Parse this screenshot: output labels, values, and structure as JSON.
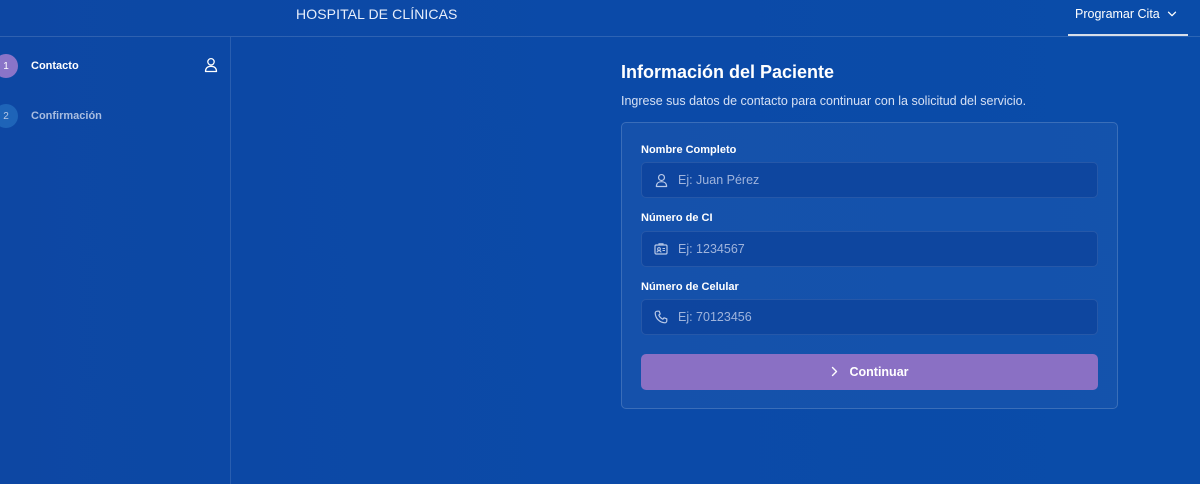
{
  "header": {
    "brand": "HOSPITAL DE CLÍNICAS",
    "nav_item": "Programar Cita",
    "nav_icon": "chevron-down-icon"
  },
  "sidebar": {
    "steps": [
      {
        "number": "1",
        "label": "Contacto",
        "icon": "user-icon",
        "active": true
      },
      {
        "number": "2",
        "label": "Confirmación",
        "active": false
      }
    ]
  },
  "main": {
    "title": "Información del Paciente",
    "subtitle": "Ingrese sus datos de contacto para continuar con la solicitud del servicio.",
    "fields": [
      {
        "label": "Nombre Completo",
        "placeholder": "Ej: Juan Pérez",
        "value": "",
        "icon": "user-icon"
      },
      {
        "label": "Número de CI",
        "placeholder": "Ej: 1234567",
        "value": "",
        "icon": "id-card-icon"
      },
      {
        "label": "Número de Celular",
        "placeholder": "Ej: 70123456",
        "value": "",
        "icon": "phone-icon"
      }
    ],
    "submit": {
      "label": "Continuar",
      "icon": "chevron-right-icon"
    }
  },
  "colors": {
    "background": "#0b4aa8",
    "accent": "#8a70c4",
    "step_inactive": "#1e64b8"
  }
}
